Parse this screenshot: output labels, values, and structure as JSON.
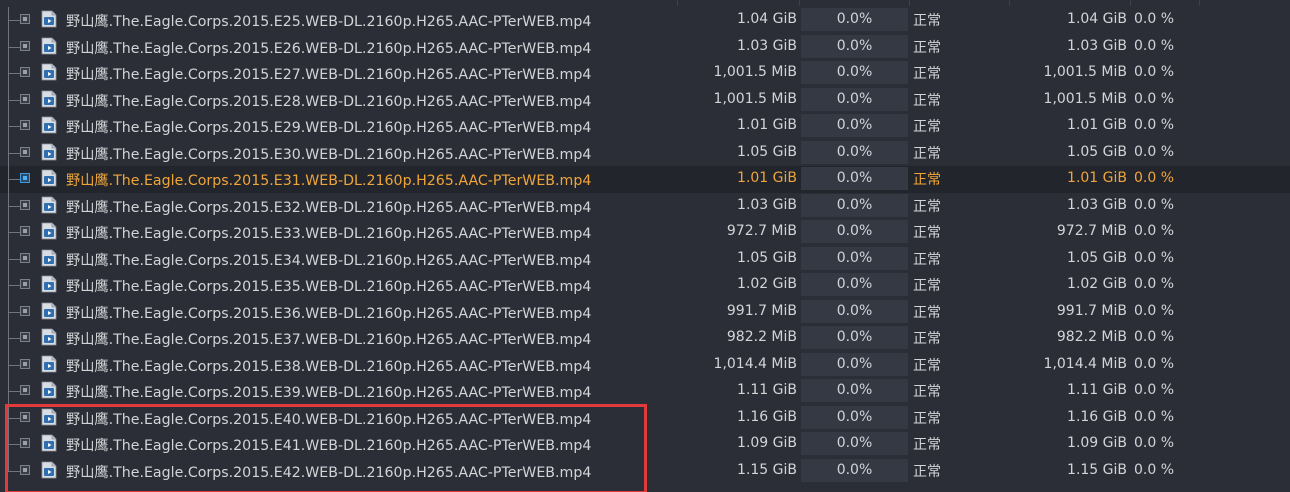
{
  "colors": {
    "background": "#2b2e36",
    "text": "#d2d4d8",
    "selected_text": "#f0a53a",
    "selected_bg": "#22252c",
    "progress_bg": "#353944",
    "progress_fill": "#3c8fd9",
    "highlight_box": "#e23a3a"
  },
  "rows": [
    {
      "name": "野山鹰.The.Eagle.Corps.2015.E25.WEB-DL.2160p.H265.AAC-PTerWEB.mp4",
      "size": "1.04 GiB",
      "progress": "0.0%",
      "progress_value": 0,
      "status": "正常",
      "remaining": "1.04 GiB",
      "availability": "0.0 %",
      "selected": false
    },
    {
      "name": "野山鹰.The.Eagle.Corps.2015.E26.WEB-DL.2160p.H265.AAC-PTerWEB.mp4",
      "size": "1.03 GiB",
      "progress": "0.0%",
      "progress_value": 0,
      "status": "正常",
      "remaining": "1.03 GiB",
      "availability": "0.0 %",
      "selected": false
    },
    {
      "name": "野山鹰.The.Eagle.Corps.2015.E27.WEB-DL.2160p.H265.AAC-PTerWEB.mp4",
      "size": "1,001.5 MiB",
      "progress": "0.0%",
      "progress_value": 0,
      "status": "正常",
      "remaining": "1,001.5 MiB",
      "availability": "0.0 %",
      "selected": false
    },
    {
      "name": "野山鹰.The.Eagle.Corps.2015.E28.WEB-DL.2160p.H265.AAC-PTerWEB.mp4",
      "size": "1,001.5 MiB",
      "progress": "0.0%",
      "progress_value": 0,
      "status": "正常",
      "remaining": "1,001.5 MiB",
      "availability": "0.0 %",
      "selected": false
    },
    {
      "name": "野山鹰.The.Eagle.Corps.2015.E29.WEB-DL.2160p.H265.AAC-PTerWEB.mp4",
      "size": "1.01 GiB",
      "progress": "0.0%",
      "progress_value": 0,
      "status": "正常",
      "remaining": "1.01 GiB",
      "availability": "0.0 %",
      "selected": false
    },
    {
      "name": "野山鹰.The.Eagle.Corps.2015.E30.WEB-DL.2160p.H265.AAC-PTerWEB.mp4",
      "size": "1.05 GiB",
      "progress": "0.0%",
      "progress_value": 0,
      "status": "正常",
      "remaining": "1.05 GiB",
      "availability": "0.0 %",
      "selected": false
    },
    {
      "name": "野山鹰.The.Eagle.Corps.2015.E31.WEB-DL.2160p.H265.AAC-PTerWEB.mp4",
      "size": "1.01 GiB",
      "progress": "0.0%",
      "progress_value": 0,
      "status": "正常",
      "remaining": "1.01 GiB",
      "availability": "0.0 %",
      "selected": true
    },
    {
      "name": "野山鹰.The.Eagle.Corps.2015.E32.WEB-DL.2160p.H265.AAC-PTerWEB.mp4",
      "size": "1.03 GiB",
      "progress": "0.0%",
      "progress_value": 0,
      "status": "正常",
      "remaining": "1.03 GiB",
      "availability": "0.0 %",
      "selected": false
    },
    {
      "name": "野山鹰.The.Eagle.Corps.2015.E33.WEB-DL.2160p.H265.AAC-PTerWEB.mp4",
      "size": "972.7 MiB",
      "progress": "0.0%",
      "progress_value": 0,
      "status": "正常",
      "remaining": "972.7 MiB",
      "availability": "0.0 %",
      "selected": false
    },
    {
      "name": "野山鹰.The.Eagle.Corps.2015.E34.WEB-DL.2160p.H265.AAC-PTerWEB.mp4",
      "size": "1.05 GiB",
      "progress": "0.0%",
      "progress_value": 0,
      "status": "正常",
      "remaining": "1.05 GiB",
      "availability": "0.0 %",
      "selected": false
    },
    {
      "name": "野山鹰.The.Eagle.Corps.2015.E35.WEB-DL.2160p.H265.AAC-PTerWEB.mp4",
      "size": "1.02 GiB",
      "progress": "0.0%",
      "progress_value": 0,
      "status": "正常",
      "remaining": "1.02 GiB",
      "availability": "0.0 %",
      "selected": false
    },
    {
      "name": "野山鹰.The.Eagle.Corps.2015.E36.WEB-DL.2160p.H265.AAC-PTerWEB.mp4",
      "size": "991.7 MiB",
      "progress": "0.0%",
      "progress_value": 0,
      "status": "正常",
      "remaining": "991.7 MiB",
      "availability": "0.0 %",
      "selected": false
    },
    {
      "name": "野山鹰.The.Eagle.Corps.2015.E37.WEB-DL.2160p.H265.AAC-PTerWEB.mp4",
      "size": "982.2 MiB",
      "progress": "0.0%",
      "progress_value": 0,
      "status": "正常",
      "remaining": "982.2 MiB",
      "availability": "0.0 %",
      "selected": false
    },
    {
      "name": "野山鹰.The.Eagle.Corps.2015.E38.WEB-DL.2160p.H265.AAC-PTerWEB.mp4",
      "size": "1,014.4 MiB",
      "progress": "0.0%",
      "progress_value": 0,
      "status": "正常",
      "remaining": "1,014.4 MiB",
      "availability": "0.0 %",
      "selected": false
    },
    {
      "name": "野山鹰.The.Eagle.Corps.2015.E39.WEB-DL.2160p.H265.AAC-PTerWEB.mp4",
      "size": "1.11 GiB",
      "progress": "0.0%",
      "progress_value": 0,
      "status": "正常",
      "remaining": "1.11 GiB",
      "availability": "0.0 %",
      "selected": false
    },
    {
      "name": "野山鹰.The.Eagle.Corps.2015.E40.WEB-DL.2160p.H265.AAC-PTerWEB.mp4",
      "size": "1.16 GiB",
      "progress": "0.0%",
      "progress_value": 0,
      "status": "正常",
      "remaining": "1.16 GiB",
      "availability": "0.0 %",
      "selected": false
    },
    {
      "name": "野山鹰.The.Eagle.Corps.2015.E41.WEB-DL.2160p.H265.AAC-PTerWEB.mp4",
      "size": "1.09 GiB",
      "progress": "0.0%",
      "progress_value": 0,
      "status": "正常",
      "remaining": "1.09 GiB",
      "availability": "0.0 %",
      "selected": false
    },
    {
      "name": "野山鹰.The.Eagle.Corps.2015.E42.WEB-DL.2160p.H265.AAC-PTerWEB.mp4",
      "size": "1.15 GiB",
      "progress": "0.0%",
      "progress_value": 0,
      "status": "正常",
      "remaining": "1.15 GiB",
      "availability": "0.0 %",
      "selected": false
    }
  ]
}
